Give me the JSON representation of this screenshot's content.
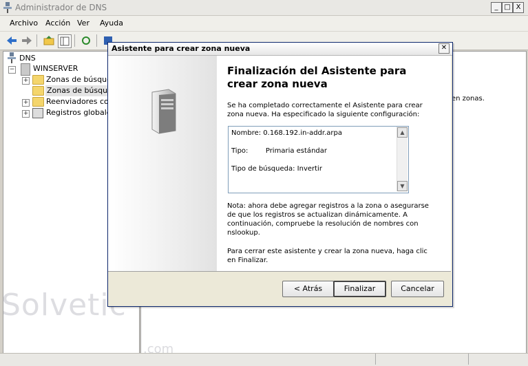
{
  "window": {
    "title": "Administrador de DNS",
    "minimize": "_",
    "maximize": "□",
    "close": "X"
  },
  "menu": [
    "Archivo",
    "Acción",
    "Ver",
    "Ayuda"
  ],
  "tree": {
    "root": "DNS",
    "server": "WINSERVER",
    "items": [
      "Zonas de búsqued",
      "Zonas de búsqued",
      "Reenviadores conc",
      "Registros globales"
    ]
  },
  "right_pane": {
    "fragment": "en zonas."
  },
  "dialog": {
    "title": "Asistente para crear zona nueva",
    "close": "✕",
    "heading": "Finalización del Asistente para crear zona nueva",
    "intro": "Se ha completado correctamente el Asistente para crear zona nueva. Ha especificado la siguiente configuración:",
    "config": {
      "nombre": "Nombre:  0.168.192.in-addr.arpa",
      "tipo": "Tipo:        Primaria estándar",
      "busqueda": "Tipo de búsqueda:  Invertir"
    },
    "note": "Nota: ahora debe agregar registros a la zona o asegurarse de que los registros se actualizan dinámicamente. A continuación, compruebe la resolución de nombres con nslookup.",
    "close_hint": "Para cerrar este asistente y crear la zona nueva, haga clic en Finalizar.",
    "buttons": {
      "back": "< Atrás",
      "finish": "Finalizar",
      "cancel": "Cancelar"
    }
  },
  "watermark": {
    "main": "Solvetic",
    "suffix": ".com"
  }
}
